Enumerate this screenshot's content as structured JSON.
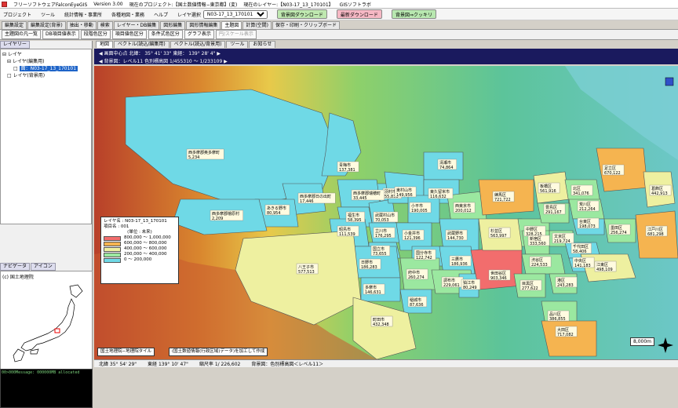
{
  "window": {
    "app_title": "フリーソフトウェアFalconEyeGIS",
    "version": "Version 3.00",
    "project": "現在のプロジェクト:【国土数値情報−東京都】(変)",
    "current_layer": "現在のレイヤー:【N03-17_13_170101】",
    "company": "GISソフトラボ"
  },
  "menu": {
    "items": [
      "プロジェクト",
      "ツール",
      "統計情報・事業所",
      "各種地図・業務",
      "ヘルプ"
    ],
    "layer_select_label": "レイヤ選択",
    "layer_select_value": "N03-17_13_170101",
    "btn_bg": "背景図ダウンロード",
    "btn_ortho": "最新ダウンロード",
    "btn_clear": "背景図⇒クッキリ"
  },
  "tabs": [
    "編集設定",
    "編集設定(背景)",
    "抽出・移動",
    "検索",
    "レイヤー・DB編集",
    "図形編集",
    "図形情報編集",
    "主題図",
    "計算(空間)",
    "保存・印刷・クリップボード"
  ],
  "tab_active_index": 7,
  "toolbar": [
    "主題図の凡一覧",
    "DB項目値表示",
    "段階色区分",
    "項目値色区分",
    "条件式色区分",
    "グラフ表示",
    "円/スケール表示"
  ],
  "left_panel": {
    "tabs": [
      "レイヤリー"
    ],
    "tree_root": "レイヤ",
    "tree_edit": "レイヤ(編集用)",
    "tree_selected": "面：N03-17_13_170101",
    "tree_bg": "レイヤ(背景用)",
    "nav_tabs": [
      "ナビゲータ",
      "アイコン"
    ],
    "nav_label": "(c) 国土地理院",
    "status_title": "00>000Message:                 000000MB allocated"
  },
  "map": {
    "tabs": [
      "地図",
      "ベクトル(読込/編集用)",
      "ベクトル(読込/背景用)",
      "ツール",
      "お知らせ"
    ],
    "active_tab": 0,
    "info1": "◀ 画面中心点    北緯：  35° 41' 33\"      東経：  139° 28' 4\"   ▶",
    "info2": "◀ 背景図：レベル11    色別標高図      1/455310 〜 1/233109 ▶",
    "zoom": "1/455310"
  },
  "legend": {
    "layer": "レイヤ名 : N03-17_13_170101",
    "item": "項目名  :   001",
    "unit": "(単位 : 未来)",
    "ranges": [
      "800,000 〜 1,000,000",
      "600,000 〜 800,000",
      "400,000 〜 600,000",
      "200,000 〜 400,000",
      "0 〜 200,000"
    ],
    "colors": [
      "#f26d6d",
      "#f5b450",
      "#eef0a0",
      "#9be8a0",
      "#6fd9e6"
    ]
  },
  "sources": [
    "国土地理院−地理院タイル",
    "(国土数値情報(行政区域)データ)を加工して作成"
  ],
  "scalebar": "8,000m",
  "statusbar": {
    "lat": "北緯  35° 54' 29\"",
    "lon": "東経  139° 10' 47\"",
    "scale": "縮尺率  1/ 226,602",
    "bg": "背景図：色別標高図＜レベル11＞"
  },
  "municipalities": [
    {
      "name": "西多摩郡奥多摩町",
      "value": "5,234"
    },
    {
      "name": "青梅市",
      "value": "137,381"
    },
    {
      "name": "西多摩郡日の出町",
      "value": "17,446"
    },
    {
      "name": "羽村市",
      "value": "55,833"
    },
    {
      "name": "西多摩郡瑞穂町",
      "value": "33,445"
    },
    {
      "name": "あきる野市",
      "value": "80,954"
    },
    {
      "name": "西多摩郡檜原村",
      "value": "2,209"
    },
    {
      "name": "福生市",
      "value": "58,395"
    },
    {
      "name": "武蔵村山市",
      "value": "70,053"
    },
    {
      "name": "清瀬市",
      "value": "74,864"
    },
    {
      "name": "東村山市",
      "value": "149,956"
    },
    {
      "name": "東久留米市",
      "value": "116,632"
    },
    {
      "name": "小平市",
      "value": "190,005"
    },
    {
      "name": "西東京市",
      "value": "200,012"
    },
    {
      "name": "立川市",
      "value": "176,295"
    },
    {
      "name": "昭島市",
      "value": "111,539"
    },
    {
      "name": "国立市",
      "value": "73,655"
    },
    {
      "name": "小金井市",
      "value": "121,396"
    },
    {
      "name": "武蔵野市",
      "value": "144,730"
    },
    {
      "name": "国分寺市",
      "value": "122,742"
    },
    {
      "name": "府中市",
      "value": "260,274"
    },
    {
      "name": "三鷹市",
      "value": "186,936"
    },
    {
      "name": "調布市",
      "value": "229,061"
    },
    {
      "name": "狛江市",
      "value": "80,249"
    },
    {
      "name": "日野市",
      "value": "186,283"
    },
    {
      "name": "八王子市",
      "value": "577,513"
    },
    {
      "name": "多摩市",
      "value": "146,631"
    },
    {
      "name": "稲城市",
      "value": "87,636"
    },
    {
      "name": "町田市",
      "value": "432,348"
    },
    {
      "name": "世田谷区",
      "value": "903,346"
    },
    {
      "name": "練馬区",
      "value": "721,722"
    },
    {
      "name": "杉並区",
      "value": "563,997"
    },
    {
      "name": "中野区",
      "value": "328,215"
    },
    {
      "name": "板橋区",
      "value": "561,916"
    },
    {
      "name": "北区",
      "value": "341,076"
    },
    {
      "name": "足立区",
      "value": "670,122"
    },
    {
      "name": "葛飾区",
      "value": "442,913"
    },
    {
      "name": "江戸川区",
      "value": "681,298"
    },
    {
      "name": "豊島区",
      "value": "291,167"
    },
    {
      "name": "荒川区",
      "value": "212,264"
    },
    {
      "name": "台東区",
      "value": "198,073"
    },
    {
      "name": "墨田区",
      "value": "256,274"
    },
    {
      "name": "文京区",
      "value": "219,724"
    },
    {
      "name": "新宿区",
      "value": "333,560"
    },
    {
      "name": "渋谷区",
      "value": "224,533"
    },
    {
      "name": "千代田区",
      "value": "58,406"
    },
    {
      "name": "中央区",
      "value": "141,183"
    },
    {
      "name": "港区",
      "value": "243,283"
    },
    {
      "name": "目黒区",
      "value": "277,622"
    },
    {
      "name": "品川区",
      "value": "386,855"
    },
    {
      "name": "大田区",
      "value": "717,082"
    },
    {
      "name": "江東区",
      "value": "498,109"
    }
  ]
}
